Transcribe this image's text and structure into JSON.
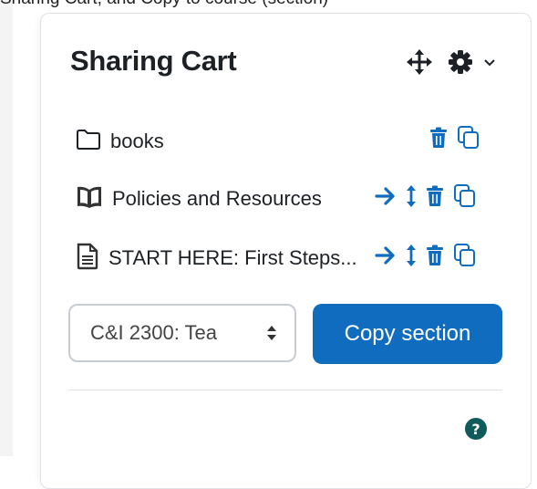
{
  "top_text": "Sharing Cart, and Copy to course (section)",
  "block": {
    "title": "Sharing Cart",
    "header_icons": [
      "move-icon",
      "gear-icon",
      "chevron-down-icon"
    ]
  },
  "items": [
    {
      "icon": "folder-icon",
      "label": "books"
    },
    {
      "icon": "book-icon",
      "label": "Policies and Resources"
    },
    {
      "icon": "file-icon",
      "label": "START HERE: First Steps..."
    }
  ],
  "course_select": {
    "value": "C&I 2300: Tea"
  },
  "copy_button": {
    "label": "Copy section"
  },
  "colors": {
    "accent": "#0f6cbf",
    "help": "#0f5a5a",
    "text": "#1d2125"
  }
}
